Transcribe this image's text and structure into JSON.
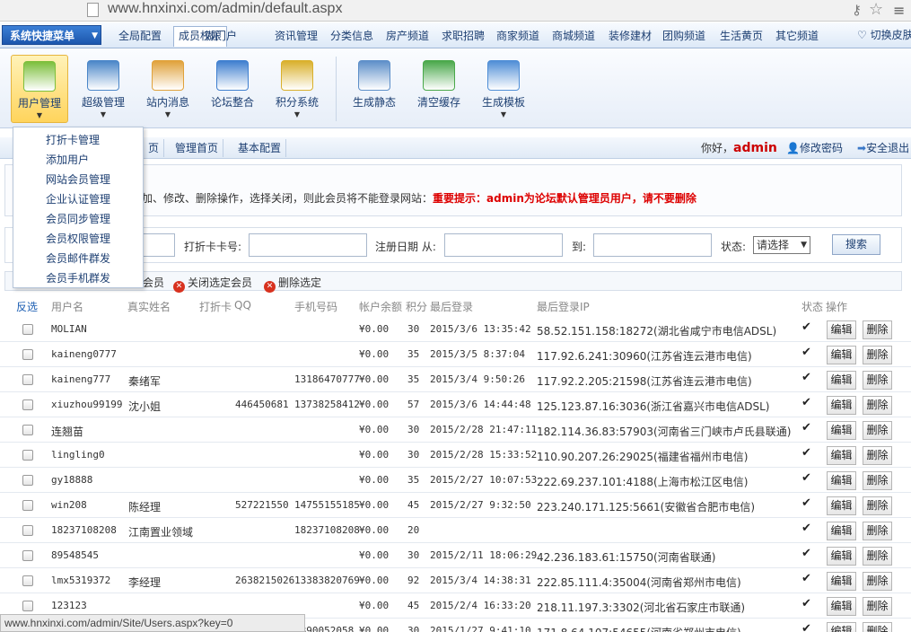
{
  "browser": {
    "url": "www.hnxinxi.com/admin/default.aspx"
  },
  "top_nav": {
    "quick_menu": "系统快捷菜单",
    "tabs": [
      "全局配置",
      "成员权限",
      "微门户",
      "资讯管理",
      "分类信息",
      "房产频道",
      "求职招聘",
      "商家频道",
      "商城频道",
      "装修建材",
      "团购频道",
      "生活黄页",
      "其它频道"
    ],
    "active_tab": "成员权限",
    "skin_switch": "切换皮肤"
  },
  "toolbar": {
    "items": [
      "用户管理",
      "超级管理",
      "站内消息",
      "论坛整合",
      "积分系统",
      "生成静态",
      "清空缓存",
      "生成模板"
    ],
    "active": "用户管理"
  },
  "dropdown": {
    "items": [
      "打折卡管理",
      "添加用户",
      "网站会员管理",
      "企业认证管理",
      "会员同步管理",
      "会员权限管理",
      "会员邮件群发",
      "会员手机群发"
    ]
  },
  "sub_bar": {
    "tabs": [
      "页",
      "管理首页",
      "基本配置"
    ],
    "greeting": "你好，",
    "user": "admin",
    "change_password": "修改密码",
    "logout": "安全退出"
  },
  "notice": {
    "text": "加、修改、删除操作，选择关闭，则此会员将不能登录网站：",
    "warning": "重要提示：admin为论坛默认管理员用户，请不要删除"
  },
  "filter": {
    "card_label": "打折卡卡号:",
    "date_from_label": "注册日期 从:",
    "date_to_label": "到:",
    "status_label": "状态:",
    "status_value": "请选择",
    "search_button": "搜索"
  },
  "actions": {
    "open_selected": "会员",
    "close_selected": "关闭选定会员",
    "delete_selected": "删除选定"
  },
  "table": {
    "headers": [
      "反选",
      "用户名",
      "真实姓名",
      "打折卡",
      "QQ",
      "手机号码",
      "帐户余额",
      "积分",
      "最后登录",
      "最后登录IP",
      "状态",
      "操作"
    ],
    "edit_label": "编辑",
    "delete_label": "删除",
    "status_mark": "✔",
    "rows": [
      {
        "user": "MOLIAN",
        "real": "",
        "qq": "",
        "phone": "",
        "balance": "¥0.00",
        "points": "30",
        "last": "2015/3/6 13:35:42",
        "ip": "58.52.151.158:18272(湖北省咸宁市电信ADSL)"
      },
      {
        "user": "kaineng0777",
        "real": "",
        "qq": "",
        "phone": "",
        "balance": "¥0.00",
        "points": "35",
        "last": "2015/3/5 8:37:04",
        "ip": "117.92.6.241:30960(江苏省连云港市电信)"
      },
      {
        "user": "kaineng777",
        "real": "秦绪军",
        "qq": "",
        "phone": "13186470777",
        "balance": "¥0.00",
        "points": "35",
        "last": "2015/3/4 9:50:26",
        "ip": "117.92.2.205:21598(江苏省连云港市电信)"
      },
      {
        "user": "xiuzhou99199",
        "real": "沈小姐",
        "qq": "446450681",
        "phone": "13738258412",
        "balance": "¥0.00",
        "points": "57",
        "last": "2015/3/6 14:44:48",
        "ip": "125.123.87.16:3036(浙江省嘉兴市电信ADSL)"
      },
      {
        "user": "连翘苗",
        "real": "",
        "qq": "",
        "phone": "",
        "balance": "¥0.00",
        "points": "30",
        "last": "2015/2/28 21:47:11",
        "ip": "182.114.36.83:57903(河南省三门峡市卢氏县联通)"
      },
      {
        "user": "lingling0",
        "real": "",
        "qq": "",
        "phone": "",
        "balance": "¥0.00",
        "points": "30",
        "last": "2015/2/28 15:33:52",
        "ip": "110.90.207.26:29025(福建省福州市电信)"
      },
      {
        "user": "gy18888",
        "real": "",
        "qq": "",
        "phone": "",
        "balance": "¥0.00",
        "points": "35",
        "last": "2015/2/27 10:07:53",
        "ip": "222.69.237.101:4188(上海市松江区电信)"
      },
      {
        "user": "win208",
        "real": "陈经理",
        "qq": "527221550",
        "phone": "14755155185",
        "balance": "¥0.00",
        "points": "45",
        "last": "2015/2/27 9:32:50",
        "ip": "223.240.171.125:5661(安徽省合肥市电信)"
      },
      {
        "user": "18237108208",
        "real": "江南置业领域",
        "qq": "",
        "phone": "18237108208",
        "balance": "¥0.00",
        "points": "20",
        "last": "",
        "ip": ""
      },
      {
        "user": "89548545",
        "real": "",
        "qq": "",
        "phone": "",
        "balance": "¥0.00",
        "points": "30",
        "last": "2015/2/11 18:06:29",
        "ip": "42.236.183.61:15750(河南省联通)"
      },
      {
        "user": "lmx5319372",
        "real": "李经理",
        "qq": "2638215026",
        "phone": "13383820769",
        "balance": "¥0.00",
        "points": "92",
        "last": "2015/3/4 14:38:31",
        "ip": "222.85.111.4:35004(河南省郑州市电信)"
      },
      {
        "user": "123123",
        "real": "",
        "qq": "",
        "phone": "",
        "balance": "¥0.00",
        "points": "45",
        "last": "2015/2/4 16:33:20",
        "ip": "218.11.197.3:3302(河北省石家庄市联通)"
      },
      {
        "user": "",
        "real": "",
        "qq": "",
        "phone": "3890052058",
        "balance": "¥0.00",
        "points": "30",
        "last": "2015/1/27 9:41:10",
        "ip": "171.8.64.107:54655(河南省郑州市电信)"
      }
    ]
  },
  "statusbar": {
    "text": "www.hnxinxi.com/admin/Site/Users.aspx?key=0"
  },
  "colors": {
    "accent": "#1c56ad",
    "warning": "#dd0000",
    "active_tool": "#ffd45c"
  }
}
